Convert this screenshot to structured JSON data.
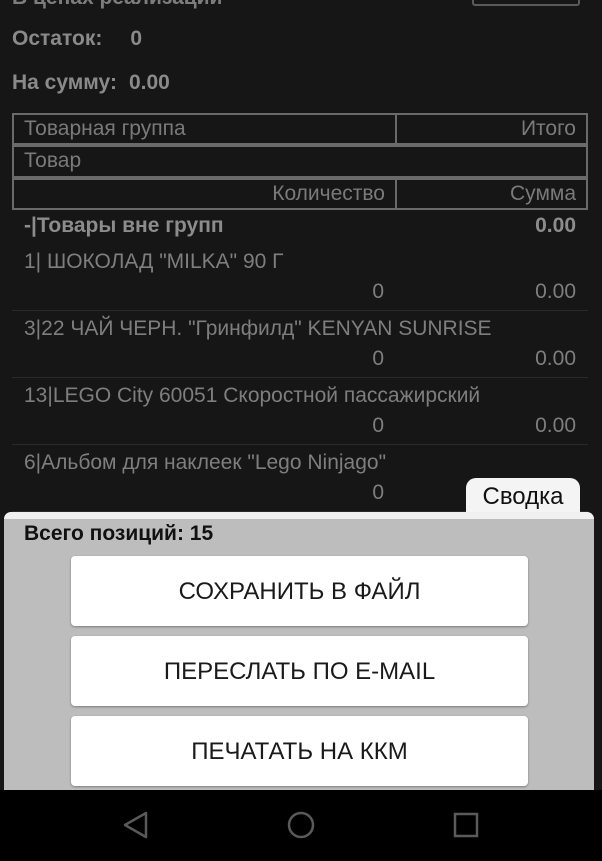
{
  "header": {
    "cut_title": "В ценах реализации"
  },
  "info": {
    "rest_label": "Остаток:",
    "rest_value": "0",
    "sum_label": "На сумму:",
    "sum_value": "0.00"
  },
  "table_header": {
    "group": "Товарная группа",
    "total": "Итого",
    "product": "Товар",
    "quantity": "Количество",
    "sum": "Сумма"
  },
  "group_row": {
    "name": "-|Товары вне групп",
    "amount": "0.00"
  },
  "rows": [
    {
      "name": "1| ШОКОЛАД \"MILKA\"  90 Г",
      "qty": "0",
      "amount": "0.00"
    },
    {
      "name": "3|22 ЧАЙ ЧЕРН. \"Гринфилд\" KENYAN SUNRISE",
      "qty": "0",
      "amount": "0.00"
    },
    {
      "name": "13|LEGO City 60051 Скоростной пассажирский",
      "qty": "0",
      "amount": "0.00"
    },
    {
      "name": "6|Альбом для наклеек \"Lego Ninjago\"",
      "qty": "0",
      "amount": ""
    }
  ],
  "summary_tab": {
    "label": "Сводка"
  },
  "sheet": {
    "title": "Всего позиций: 15",
    "save_label": "СОХРАНИТЬ В ФАЙЛ",
    "email_label": "ПЕРЕСЛАТЬ ПО E-MAIL",
    "print_label": "ПЕЧАТАТЬ НА ККМ"
  },
  "navbar": {
    "icons": [
      "back-icon",
      "home-icon",
      "recents-icon"
    ]
  },
  "colors": {
    "background": "#161616",
    "sheet": "#bdbdbd",
    "button": "#ffffff"
  }
}
